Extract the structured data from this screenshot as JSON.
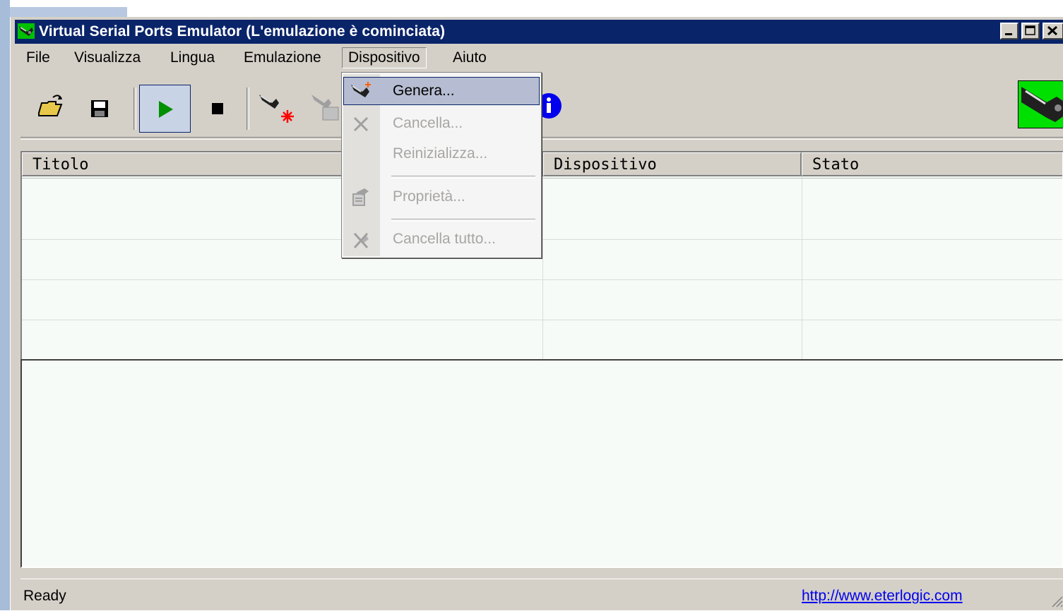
{
  "window": {
    "title": "Virtual Serial Ports Emulator (L'emulazione è cominciata)"
  },
  "menubar": {
    "items": [
      "File",
      "Visualizza",
      "Lingua",
      "Emulazione",
      "Dispositivo",
      "Aiuto"
    ],
    "open_menu": "Dispositivo"
  },
  "dropdown": {
    "items": [
      {
        "label": "Genera...",
        "enabled": true,
        "highlighted": true
      },
      {
        "label": "Cancella...",
        "enabled": false
      },
      {
        "label": "Reinizializza...",
        "enabled": false
      },
      {
        "label": "Proprietà...",
        "enabled": false
      },
      {
        "label": "Cancella tutto...",
        "enabled": false
      }
    ]
  },
  "toolbar": {
    "buttons": [
      "open-icon",
      "save-icon",
      "play-icon",
      "stop-icon",
      "device-new-icon",
      "device-properties-icon",
      "info-icon"
    ],
    "pressed": "play-icon"
  },
  "list": {
    "columns": [
      "Titolo",
      "Dispositivo",
      "Stato"
    ]
  },
  "statusbar": {
    "text": "Ready",
    "link": "http://www.eterlogic.com"
  },
  "colors": {
    "titlebar": "#0a246a",
    "menu_highlight": "#b6bdd2",
    "list_background": "#f7fbf7"
  }
}
